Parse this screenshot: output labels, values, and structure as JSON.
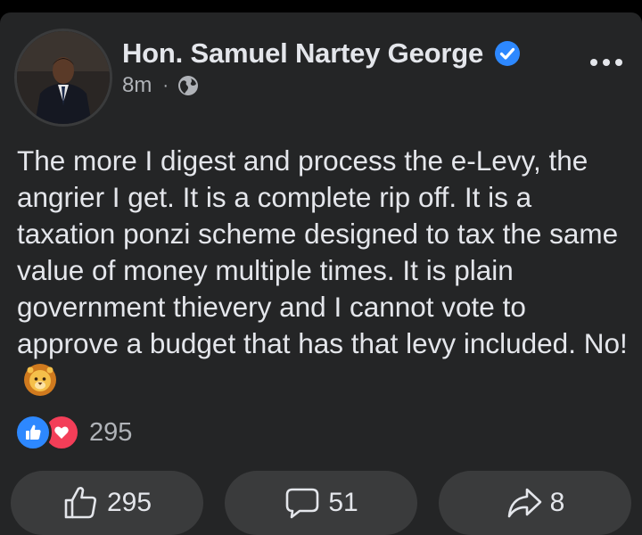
{
  "post": {
    "author": "Hon. Samuel Nartey George",
    "time": "8m",
    "separator": "·",
    "audience_icon": "globe-icon",
    "verified_icon": "verified-badge-icon",
    "text": "The more I digest and process the e-Levy, the angrier I get. It is a complete rip off. It is a taxation ponzi scheme designed to tax the same value of money multiple times. It is plain government thievery and I cannot vote to approve a budget that has that levy included. No!",
    "emoji": "lion-face-emoji"
  },
  "reactions": {
    "icons": [
      "like-icon",
      "love-icon"
    ],
    "count": "295"
  },
  "actions": {
    "like_count": "295",
    "comment_count": "51",
    "share_count": "8"
  },
  "colors": {
    "background": "#242526",
    "accent": "#2d88ff",
    "love": "#f33e58",
    "button": "#3a3b3c",
    "secondary_text": "#b0b3b8"
  }
}
